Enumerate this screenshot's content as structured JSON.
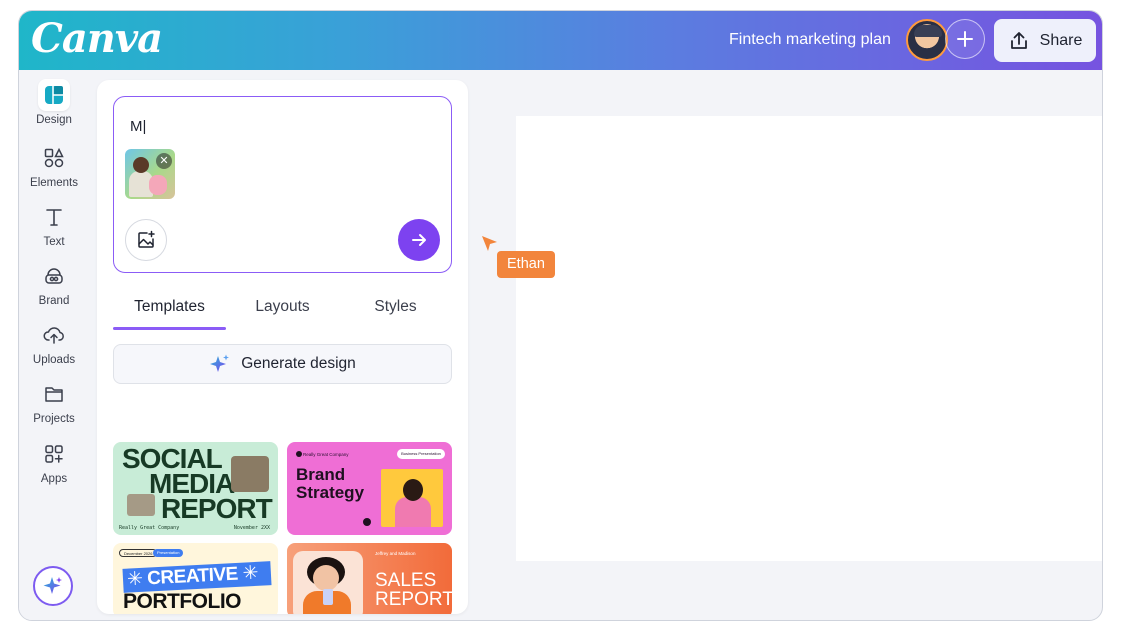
{
  "header": {
    "logo": "Canva",
    "doc_title": "Fintech marketing plan",
    "share_label": "Share",
    "gradient": [
      "#1fb6c9",
      "#7653e0"
    ]
  },
  "rail": {
    "items": [
      {
        "label": "Design",
        "icon": "design-icon",
        "active": true
      },
      {
        "label": "Elements",
        "icon": "elements-icon"
      },
      {
        "label": "Text",
        "icon": "text-icon"
      },
      {
        "label": "Brand",
        "icon": "brand-icon"
      },
      {
        "label": "Uploads",
        "icon": "uploads-icon"
      },
      {
        "label": "Projects",
        "icon": "projects-icon"
      },
      {
        "label": "Apps",
        "icon": "apps-icon"
      }
    ],
    "magic_icon": "sparkle-icon"
  },
  "panel": {
    "prompt_value": "M|",
    "tabs": [
      {
        "label": "Templates",
        "active": true
      },
      {
        "label": "Layouts"
      },
      {
        "label": "Styles"
      }
    ],
    "generate_label": "Generate design",
    "accent": "#8b5cf6"
  },
  "templates": {
    "social": {
      "line1": "SOCIAL",
      "line2": "MEDIA",
      "line3": "REPORT",
      "footer_left": "Really Great Company",
      "footer_right": "November 2XX"
    },
    "brand": {
      "title_line1": "Brand",
      "title_line2": "Strategy",
      "small": "Really Great Company",
      "pill": "Business Presentation"
    },
    "portfolio": {
      "date": "December 2026",
      "tag": "Presentation",
      "word1": "✳ CREATIVE ✳",
      "word2": "PORTFOLIO"
    },
    "sales": {
      "small": "Jeffrey and Madison",
      "line1": "SALES",
      "line2": "REPORT"
    }
  },
  "collaborator": {
    "name": "Ethan",
    "color": "#f2853c"
  }
}
